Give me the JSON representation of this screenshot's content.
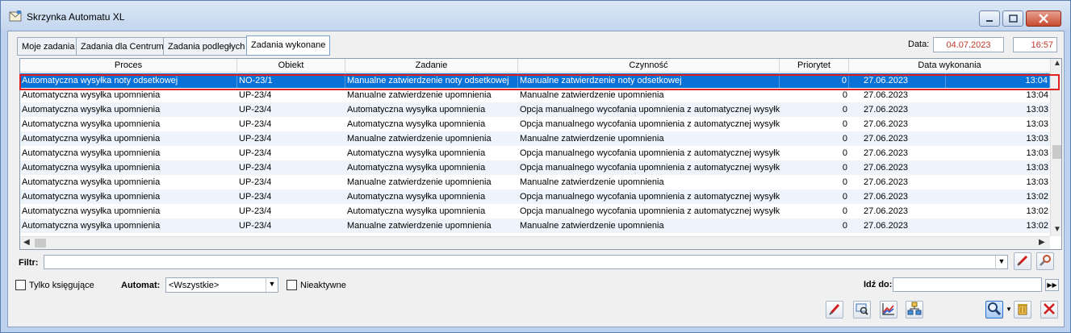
{
  "window": {
    "title": "Skrzynka Automatu XL"
  },
  "tabs": [
    {
      "label": "Moje zadania"
    },
    {
      "label": "Zadania dla Centrum"
    },
    {
      "label": "Zadania podległych"
    },
    {
      "label": "Zadania wykonane",
      "active": true
    }
  ],
  "header": {
    "date_label": "Data:",
    "date_value": "04.07.2023",
    "time_value": "16:57"
  },
  "table": {
    "columns": [
      "Proces",
      "Obiekt",
      "Zadanie",
      "Czynność",
      "Priorytet",
      "Data wykonania"
    ],
    "selected_row": 0,
    "rows": [
      [
        "Automatyczna wysyłka noty odsetkowej",
        "NO-23/1",
        "Manualne zatwierdzenie noty odsetkowej",
        "Manualne zatwierdzenie noty odsetkowej",
        "0",
        "27.06.2023",
        "13:04"
      ],
      [
        "Automatyczna wysyłka upomnienia",
        "UP-23/4",
        "Manualne zatwierdzenie upomnienia",
        "Manualne zatwierdzenie upomnienia",
        "0",
        "27.06.2023",
        "13:04"
      ],
      [
        "Automatyczna wysyłka upomnienia",
        "UP-23/4",
        "Automatyczna wysyłka upomnienia",
        "Opcja manualnego wycofania upomnienia z automatycznej wysyłki",
        "0",
        "27.06.2023",
        "13:03"
      ],
      [
        "Automatyczna wysyłka upomnienia",
        "UP-23/4",
        "Automatyczna wysyłka upomnienia",
        "Opcja manualnego wycofania upomnienia z automatycznej wysyłki",
        "0",
        "27.06.2023",
        "13:03"
      ],
      [
        "Automatyczna wysyłka upomnienia",
        "UP-23/4",
        "Manualne zatwierdzenie upomnienia",
        "Manualne zatwierdzenie upomnienia",
        "0",
        "27.06.2023",
        "13:03"
      ],
      [
        "Automatyczna wysyłka upomnienia",
        "UP-23/4",
        "Automatyczna wysyłka upomnienia",
        "Opcja manualnego wycofania upomnienia z automatycznej wysyłki",
        "0",
        "27.06.2023",
        "13:03"
      ],
      [
        "Automatyczna wysyłka upomnienia",
        "UP-23/4",
        "Automatyczna wysyłka upomnienia",
        "Opcja manualnego wycofania upomnienia z automatycznej wysyłki",
        "0",
        "27.06.2023",
        "13:03"
      ],
      [
        "Automatyczna wysyłka upomnienia",
        "UP-23/4",
        "Manualne zatwierdzenie upomnienia",
        "Manualne zatwierdzenie upomnienia",
        "0",
        "27.06.2023",
        "13:03"
      ],
      [
        "Automatyczna wysyłka upomnienia",
        "UP-23/4",
        "Automatyczna wysyłka upomnienia",
        "Opcja manualnego wycofania upomnienia z automatycznej wysyłki",
        "0",
        "27.06.2023",
        "13:02"
      ],
      [
        "Automatyczna wysyłka upomnienia",
        "UP-23/4",
        "Automatyczna wysyłka upomnienia",
        "Opcja manualnego wycofania upomnienia z automatycznej wysyłki",
        "0",
        "27.06.2023",
        "13:02"
      ],
      [
        "Automatyczna wysyłka upomnienia",
        "UP-23/4",
        "Manualne zatwierdzenie upomnienia",
        "Manualne zatwierdzenie upomnienia",
        "0",
        "27.06.2023",
        "13:02"
      ]
    ]
  },
  "filter": {
    "label": "Filtr:",
    "value": ""
  },
  "bottom": {
    "only_posting_label": "Tylko księgujące",
    "automat_label": "Automat:",
    "automat_value": "<Wszystkie>",
    "inactive_label": "Nieaktywne",
    "goto_label": "Idź do:",
    "goto_value": ""
  },
  "icons": {
    "window": "mail-window-icon",
    "filter_clear": "clear-filter-icon",
    "filter_tools": "filter-tools-icon",
    "actions": [
      "clear-icon",
      "preview-icon",
      "chart-icon",
      "hierarchy-icon",
      "search-icon",
      "delete-icon",
      "close-icon"
    ]
  },
  "colors": {
    "selection": "#0a72d6",
    "highlight_outline": "#e02020",
    "date_text": "#c0392b"
  }
}
